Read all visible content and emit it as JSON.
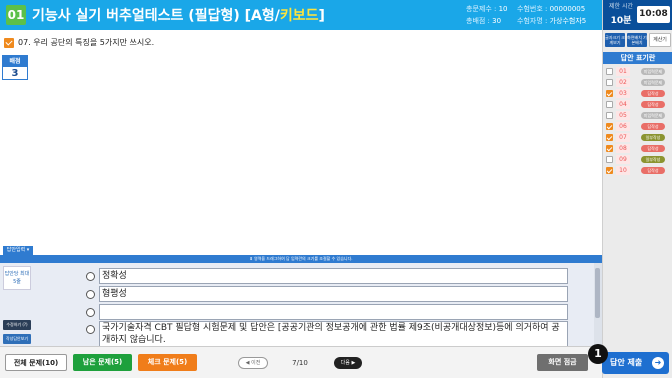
{
  "header": {
    "question_no": "01",
    "title_pre": "기능사 실기 버추얼테스트 (필답형) [A형/",
    "title_hl": "키보드",
    "title_post": "]",
    "total_label": "총문제수 : ",
    "total_value": "10",
    "score_label": "총배점 : ",
    "score_value": "30",
    "exam_no_label": "수험번호 : ",
    "exam_no_value": "00000005",
    "name_label": "수험자명 : ",
    "name_value": "가상수험자5"
  },
  "timer": {
    "label": "제한 시간",
    "limit": "10분",
    "clock": "10:08"
  },
  "tools": {
    "t1": "글자크기 크게보기",
    "t2": "화면배치 기본배치",
    "t3": "계산기"
  },
  "answer_sheet": {
    "title": "답안 표기란",
    "items": [
      {
        "num": "01",
        "badge": "미입력문제",
        "checked": false,
        "color": "gray"
      },
      {
        "num": "02",
        "badge": "미입력문제",
        "checked": false,
        "color": "gray"
      },
      {
        "num": "03",
        "badge": "답작성",
        "checked": true,
        "color": "red"
      },
      {
        "num": "04",
        "badge": "답작성",
        "checked": false,
        "color": "red"
      },
      {
        "num": "05",
        "badge": "미입력문제",
        "checked": false,
        "color": "gray"
      },
      {
        "num": "06",
        "badge": "답작성",
        "checked": true,
        "color": "red"
      },
      {
        "num": "07",
        "badge": "일부작성",
        "checked": true,
        "color": "olive"
      },
      {
        "num": "08",
        "badge": "답작성",
        "checked": true,
        "color": "red"
      },
      {
        "num": "09",
        "badge": "일부작성",
        "checked": false,
        "color": "olive"
      },
      {
        "num": "10",
        "badge": "답작성",
        "checked": true,
        "color": "red"
      }
    ]
  },
  "question": {
    "text": "07. 우리 공단의 특징을 5가지만 쓰시오.",
    "score_label": "배점",
    "score_value": "3"
  },
  "answer_area": {
    "tab_label": "답안입력 ▾",
    "divider_text": "⬍ 영역을 드래그하여 답 입력란의 크기를 조절할 수 있습니다.",
    "side_label": "답안당 최대 5줄",
    "side_btn1": "수정하기 (?)",
    "side_btn2": "작성답안보기",
    "options": [
      "정확성",
      "형평성",
      "",
      "국가기술자격 CBT 필답형 시험문제 및 답안은 [공공기관의 정보공개에 관한 법률 제9조(비공개대상정보)등에 의거하여 공개하지 않습니다."
    ]
  },
  "footer": {
    "all_btn": "전체 문제(10)",
    "remain_btn": "남은 문제(5)",
    "check_btn": "체크 문제(5)",
    "prev": "◀ 이전",
    "page": "7/10",
    "next": "다음 ▶",
    "zoom_btn": "화면 점금",
    "submit_btn": "답안 제출",
    "marker": "1"
  }
}
